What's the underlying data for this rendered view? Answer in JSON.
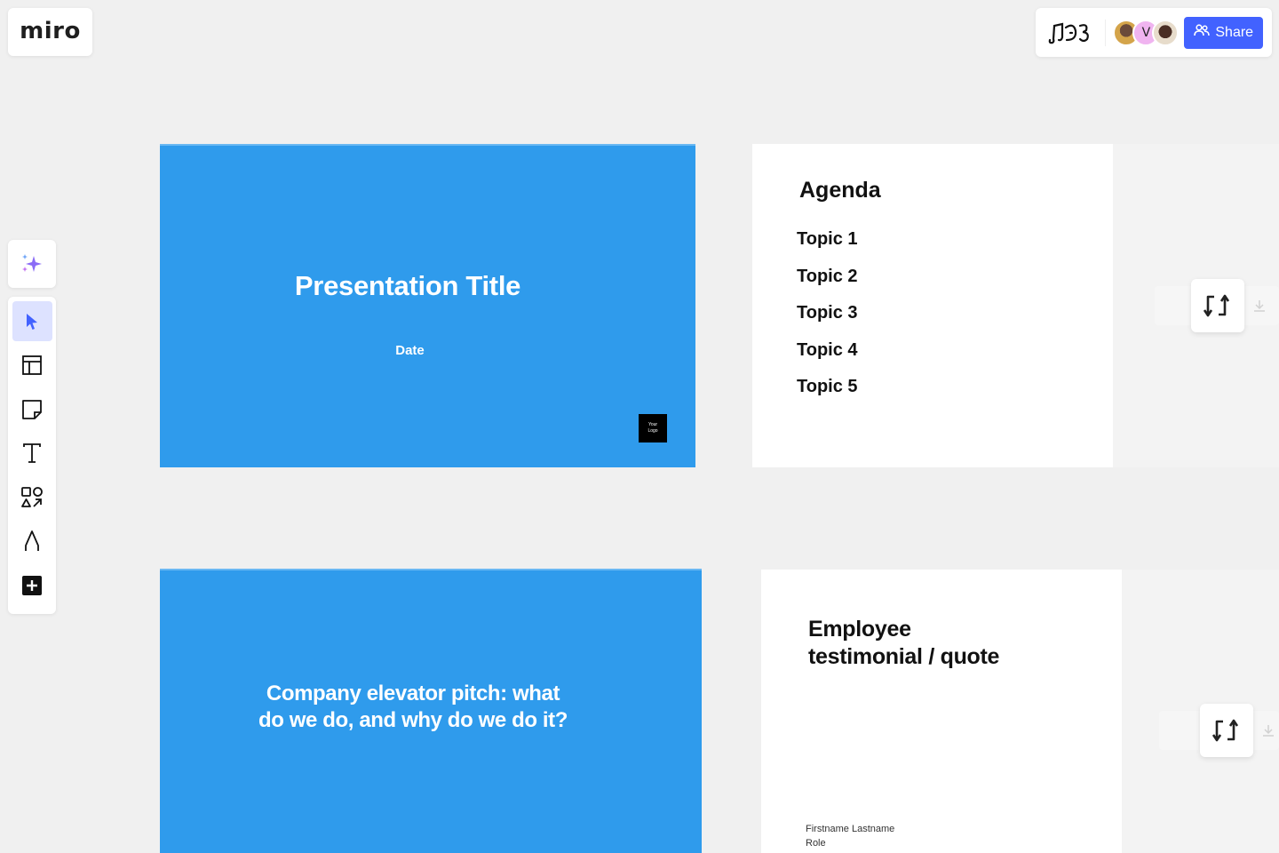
{
  "app": {
    "logo_text": "miro"
  },
  "header": {
    "board_icon": "board-doodle-icon",
    "collaborators": [
      {
        "name": "collaborator-photo-1",
        "initial": ""
      },
      {
        "name": "collaborator-v",
        "initial": "V"
      },
      {
        "name": "collaborator-photo-2",
        "initial": ""
      }
    ],
    "share_label": "Share",
    "share_color": "#4262ff"
  },
  "toolbar": {
    "ai_icon": "sparkle-icon",
    "tools": [
      {
        "name": "select",
        "icon": "cursor-icon",
        "active": true
      },
      {
        "name": "templates",
        "icon": "layout-icon",
        "active": false
      },
      {
        "name": "sticky-note",
        "icon": "sticky-note-icon",
        "active": false
      },
      {
        "name": "text",
        "icon": "text-icon",
        "active": false
      },
      {
        "name": "shapes",
        "icon": "shapes-icon",
        "active": false
      },
      {
        "name": "pen",
        "icon": "pen-icon",
        "active": false
      },
      {
        "name": "more",
        "icon": "plus-icon",
        "active": false
      }
    ]
  },
  "slides": {
    "title_slide": {
      "title": "Presentation Title",
      "date": "Date",
      "logo_line1": "Your",
      "logo_line2": "Logo",
      "bg_color": "#2f9bec"
    },
    "agenda": {
      "title": "Agenda",
      "topics": [
        "Topic 1",
        "Topic 2",
        "Topic 3",
        "Topic 4",
        "Topic 5"
      ]
    },
    "pitch": {
      "text": "Company elevator pitch: what do we do, and why do we do it?"
    },
    "testimonial": {
      "title_line1": "Employee",
      "title_line2": "testimonial / quote",
      "name": "Firstname Lastname",
      "role": "Role"
    }
  },
  "canvas_controls": {
    "swap_icon": "swap-arrows-icon",
    "download_icon": "download-icon"
  }
}
